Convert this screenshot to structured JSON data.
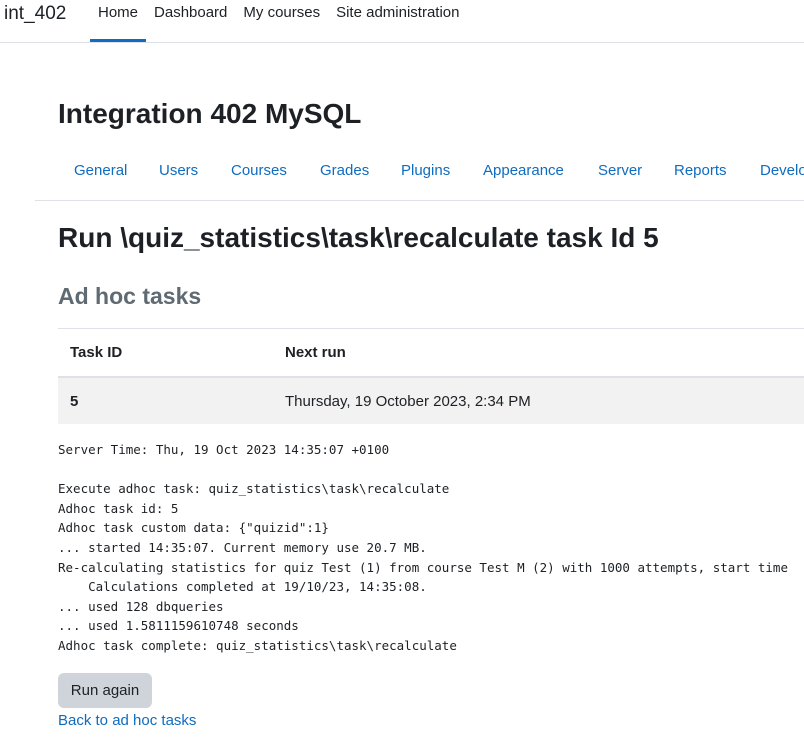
{
  "site": {
    "brand": "int_402",
    "primary_nav": [
      "Home",
      "Dashboard",
      "My courses",
      "Site administration"
    ],
    "active_nav": "Home",
    "title": "Integration 402 MySQL"
  },
  "secondary_nav": {
    "tabs": [
      "General",
      "Users",
      "Courses",
      "Grades",
      "Plugins",
      "Appearance",
      "Server",
      "Reports",
      "Development"
    ]
  },
  "page": {
    "heading": "Run \\quiz_statistics\\task\\recalculate task Id 5",
    "section_heading": "Ad hoc tasks"
  },
  "table": {
    "headers": {
      "task_id": "Task ID",
      "next_run": "Next run"
    },
    "rows": [
      {
        "task_id": "5",
        "next_run": "Thursday, 19 October 2023, 2:34 PM"
      }
    ]
  },
  "output": {
    "lines": [
      "Server Time: Thu, 19 Oct 2023 14:35:07 +0100",
      "",
      "Execute adhoc task: quiz_statistics\\task\\recalculate",
      "Adhoc task id: 5",
      "Adhoc task custom data: {\"quizid\":1}",
      "... started 14:35:07. Current memory use 20.7 MB.",
      "Re-calculating statistics for quiz Test (1) from course Test M (2) with 1000 attempts, start time",
      "    Calculations completed at 19/10/23, 14:35:08.",
      "... used 128 dbqueries",
      "... used 1.5811159610748 seconds",
      "Adhoc task complete: quiz_statistics\\task\\recalculate"
    ]
  },
  "actions": {
    "run_again": "Run again",
    "back_link": "Back to ad hoc tasks"
  },
  "colors": {
    "link": "#0f6cbf",
    "active_underline": "#0f6cbf",
    "button_bg": "#ced4da",
    "section_heading": "#5f6a72"
  }
}
